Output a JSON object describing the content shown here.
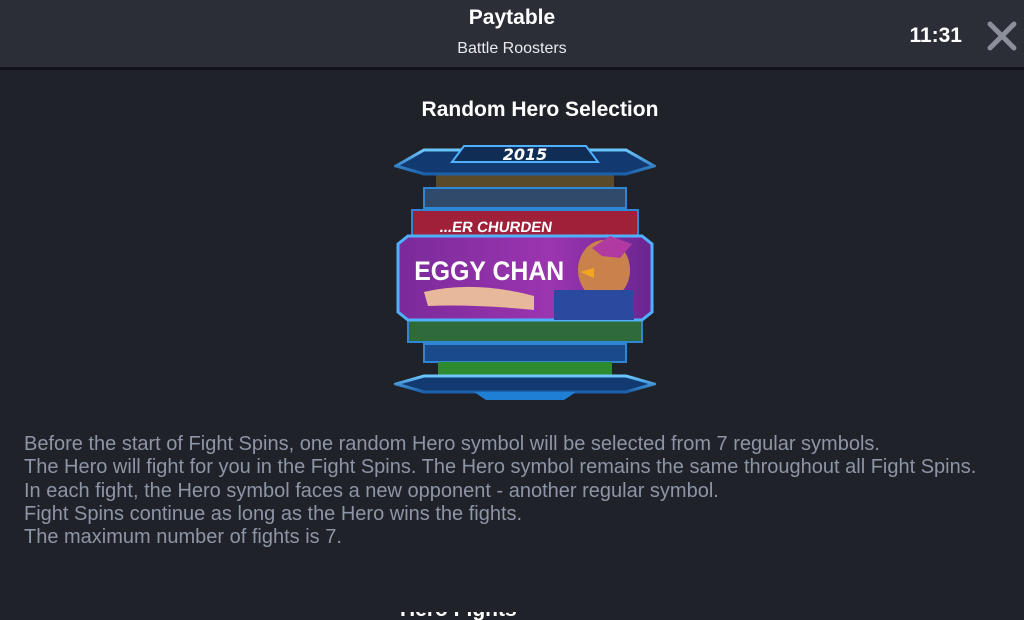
{
  "header": {
    "title": "Paytable",
    "subtitle": "Battle Roosters",
    "clock": "11:31",
    "close_icon": "close-x-icon"
  },
  "section": {
    "title": "Random Hero Selection",
    "image": {
      "year_label": "2015",
      "selected_hero_label": "EGGY CHAN",
      "partial_label": "...ER CHURDEN",
      "colors": {
        "frame": "#1e7fd3",
        "frame_light": "#58b8ff",
        "selected_panel": "#8a2fa0",
        "strip_red": "#a0203a",
        "strip_blue": "#1b4a8a",
        "strip_green": "#2f6b3a"
      }
    },
    "description": [
      "Before the start of Fight Spins, one random Hero symbol will be selected from 7 regular symbols.",
      "The Hero will fight for you in the Fight Spins. The Hero symbol remains the same throughout all Fight Spins.",
      "In each fight, the Hero symbol faces a new opponent - another regular symbol.",
      "Fight Spins continue as long as the Hero wins the fights.",
      "The maximum number of fights is 7."
    ]
  },
  "next_section": {
    "title": "Hero Fights"
  }
}
